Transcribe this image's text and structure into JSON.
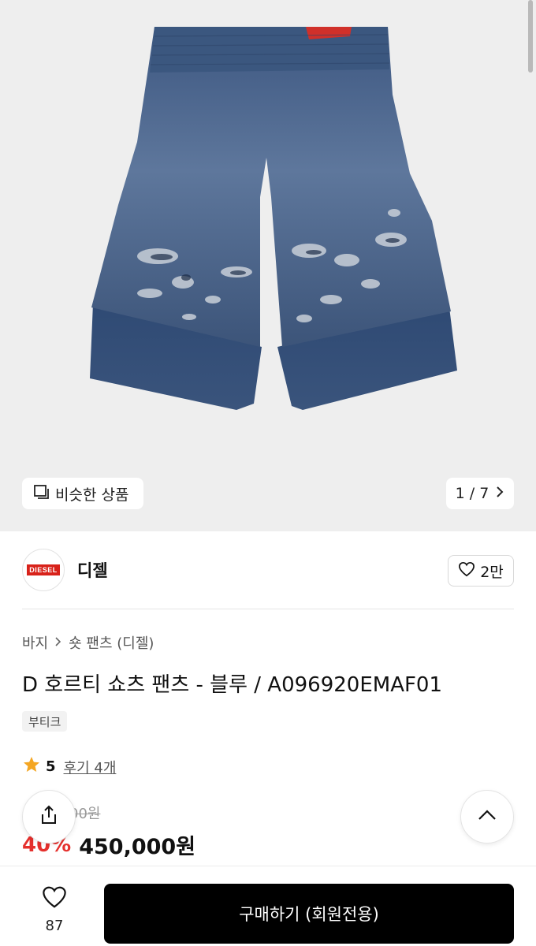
{
  "gallery": {
    "similar_label": "비슷한 상품",
    "counter": "1 / 7"
  },
  "brand": {
    "logo_text": "DIESEL",
    "name": "디젤",
    "likes": "2만"
  },
  "breadcrumb": {
    "category": "바지",
    "subcategory": "숏 팬츠 (디젤)"
  },
  "product": {
    "title": "D 호르티 쇼츠 팬츠 - 블루 / A096920EMAF01",
    "tag": "부티크",
    "rating": "5",
    "reviews": "후기 4개",
    "original_price_visible": "00원",
    "discount_visible": "40%",
    "sale_price": "450,000원"
  },
  "bottom_bar": {
    "wish_count": "87",
    "buy_label": "구매하기 (회원전용)"
  },
  "colors": {
    "accent_red": "#e5302d",
    "star": "#f4a623",
    "buy_button": "#000000"
  },
  "icons": [
    "similar-icon",
    "chevron-right-icon",
    "heart-icon",
    "star-icon",
    "share-icon",
    "chevron-up-icon"
  ]
}
